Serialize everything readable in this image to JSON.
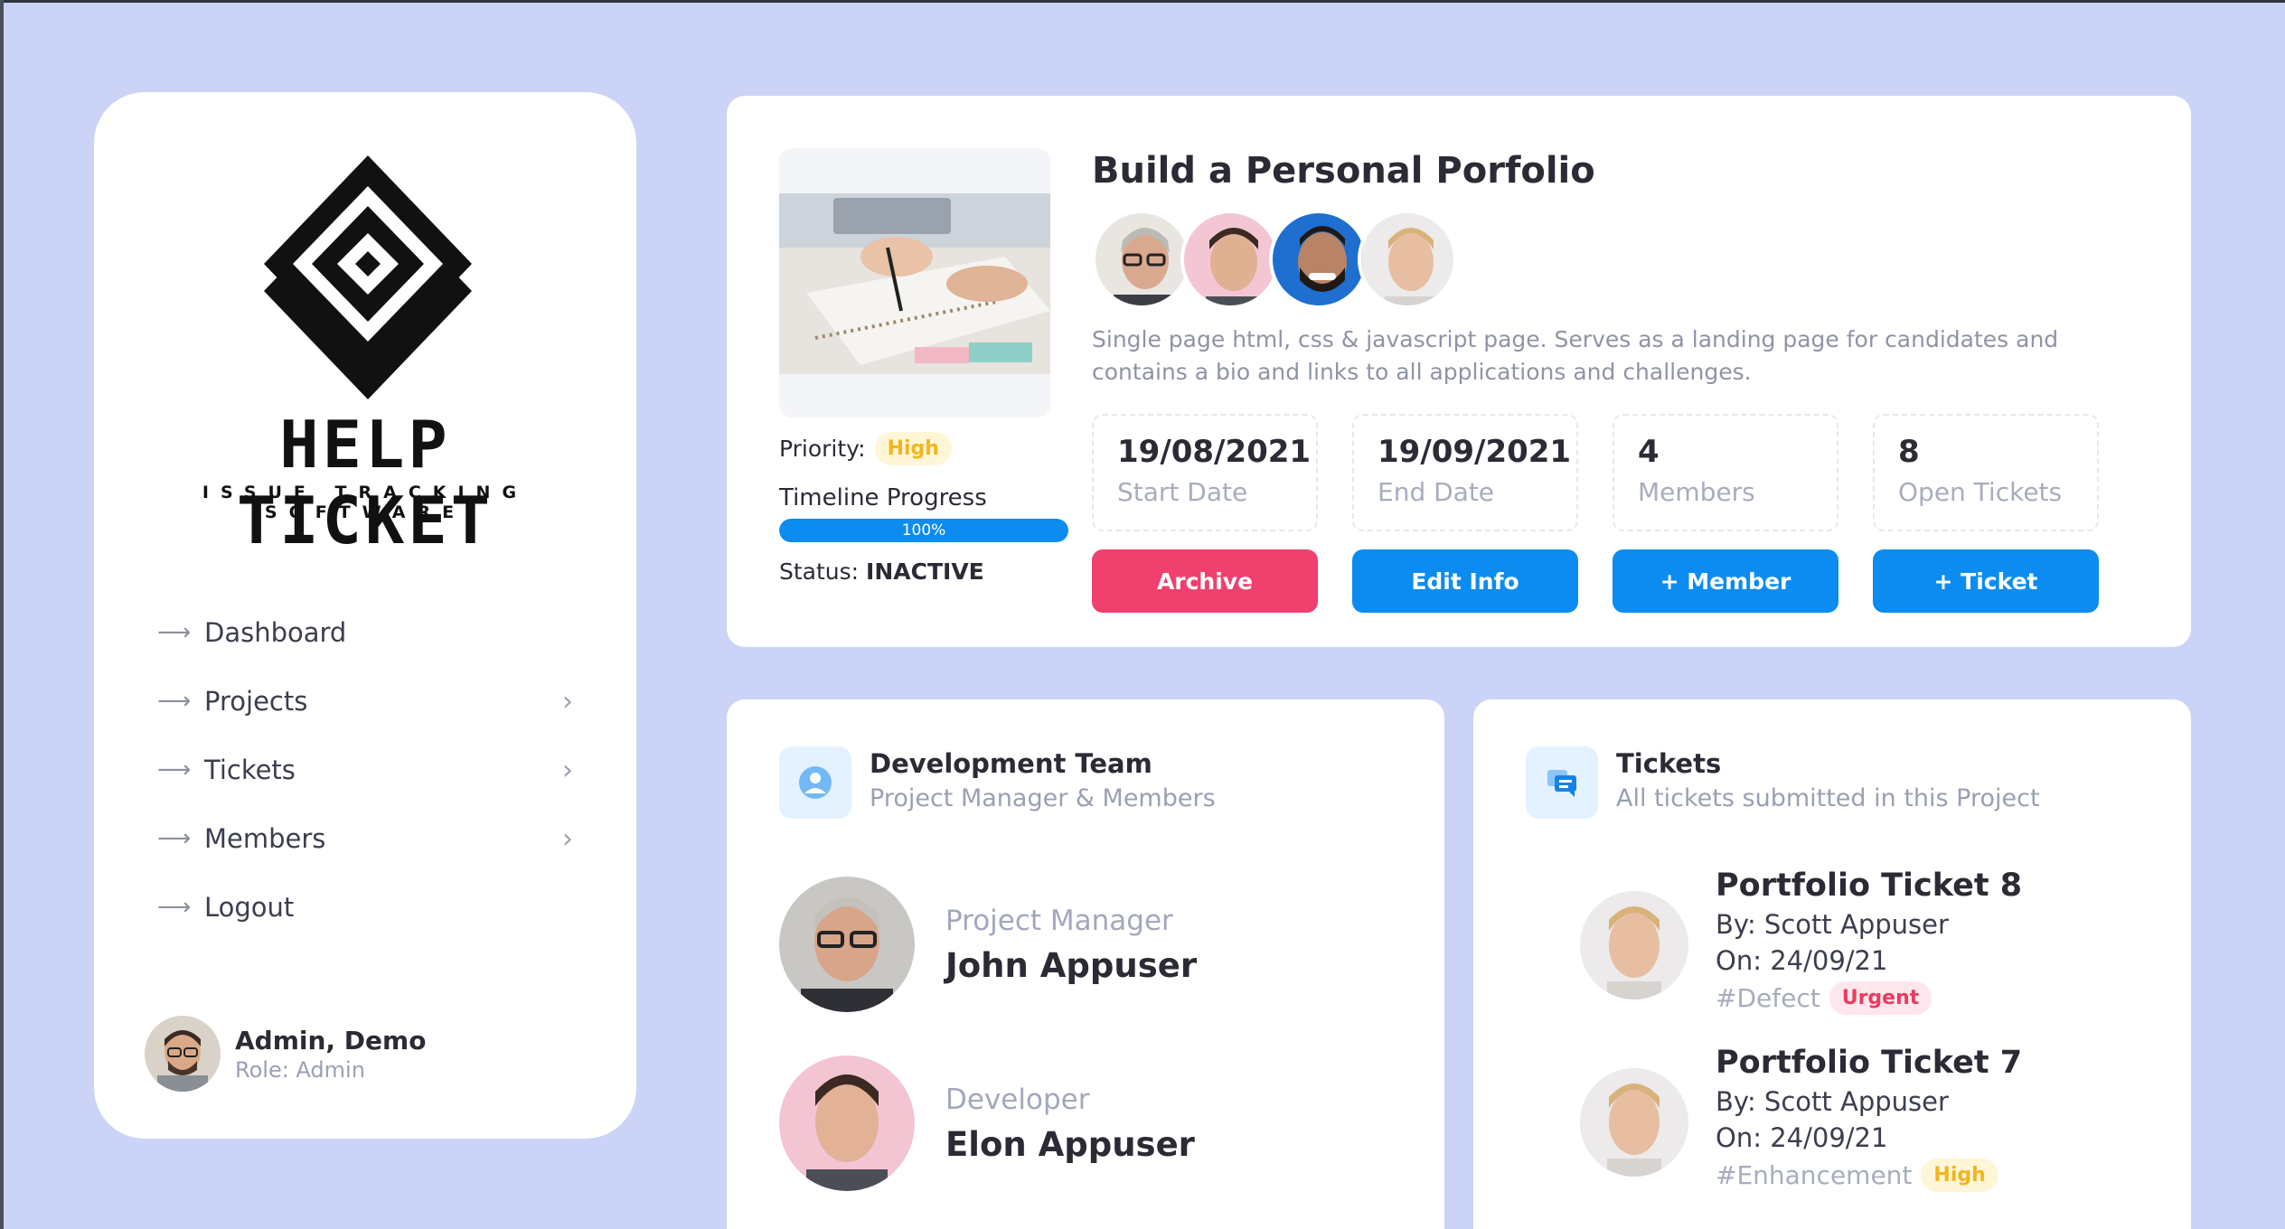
{
  "brand": {
    "name": "HELP TICKET",
    "tagline": "ISSUE TRACKING SOFTWARE"
  },
  "nav": [
    {
      "label": "Dashboard",
      "has_children": false
    },
    {
      "label": "Projects",
      "has_children": true
    },
    {
      "label": "Tickets",
      "has_children": true
    },
    {
      "label": "Members",
      "has_children": true
    },
    {
      "label": "Logout",
      "has_children": false
    }
  ],
  "user": {
    "name": "Admin, Demo",
    "role": "Role: Admin"
  },
  "project": {
    "title": "Build a Personal Porfolio",
    "description": "Single page html, css & javascript page. Serves as a landing page for candidates and contains a bio and links to all applications and challenges.",
    "priority_label": "Priority:",
    "priority": "High",
    "timeline_label": "Timeline Progress",
    "progress_value": 100,
    "progress_text": "100%",
    "status_label": "Status:",
    "status": "INACTIVE",
    "stats": [
      {
        "value": "19/08/2021",
        "label": "Start Date"
      },
      {
        "value": "19/09/2021",
        "label": "End Date"
      },
      {
        "value": "4",
        "label": "Members"
      },
      {
        "value": "8",
        "label": "Open Tickets"
      }
    ],
    "buttons": {
      "archive": "Archive",
      "edit": "Edit Info",
      "add_member": "+ Member",
      "add_ticket": "+ Ticket"
    }
  },
  "team": {
    "title": "Development Team",
    "subtitle": "Project Manager & Members",
    "members": [
      {
        "role": "Project Manager",
        "name": "John Appuser"
      },
      {
        "role": "Developer",
        "name": "Elon Appuser"
      }
    ]
  },
  "tickets": {
    "title": "Tickets",
    "subtitle": "All tickets submitted in this Project",
    "items": [
      {
        "title": "Portfolio Ticket 8",
        "by": "By: Scott Appuser",
        "on": "On: 24/09/21",
        "tag": "#Defect",
        "badge": "Urgent"
      },
      {
        "title": "Portfolio Ticket 7",
        "by": "By: Scott Appuser",
        "on": "On: 24/09/21",
        "tag": "#Enhancement",
        "badge": "High"
      }
    ]
  },
  "colors": {
    "background": "#cbd3f6",
    "primary": "#0c8cf0",
    "danger": "#f0406e",
    "warning": "#f2b51c"
  }
}
